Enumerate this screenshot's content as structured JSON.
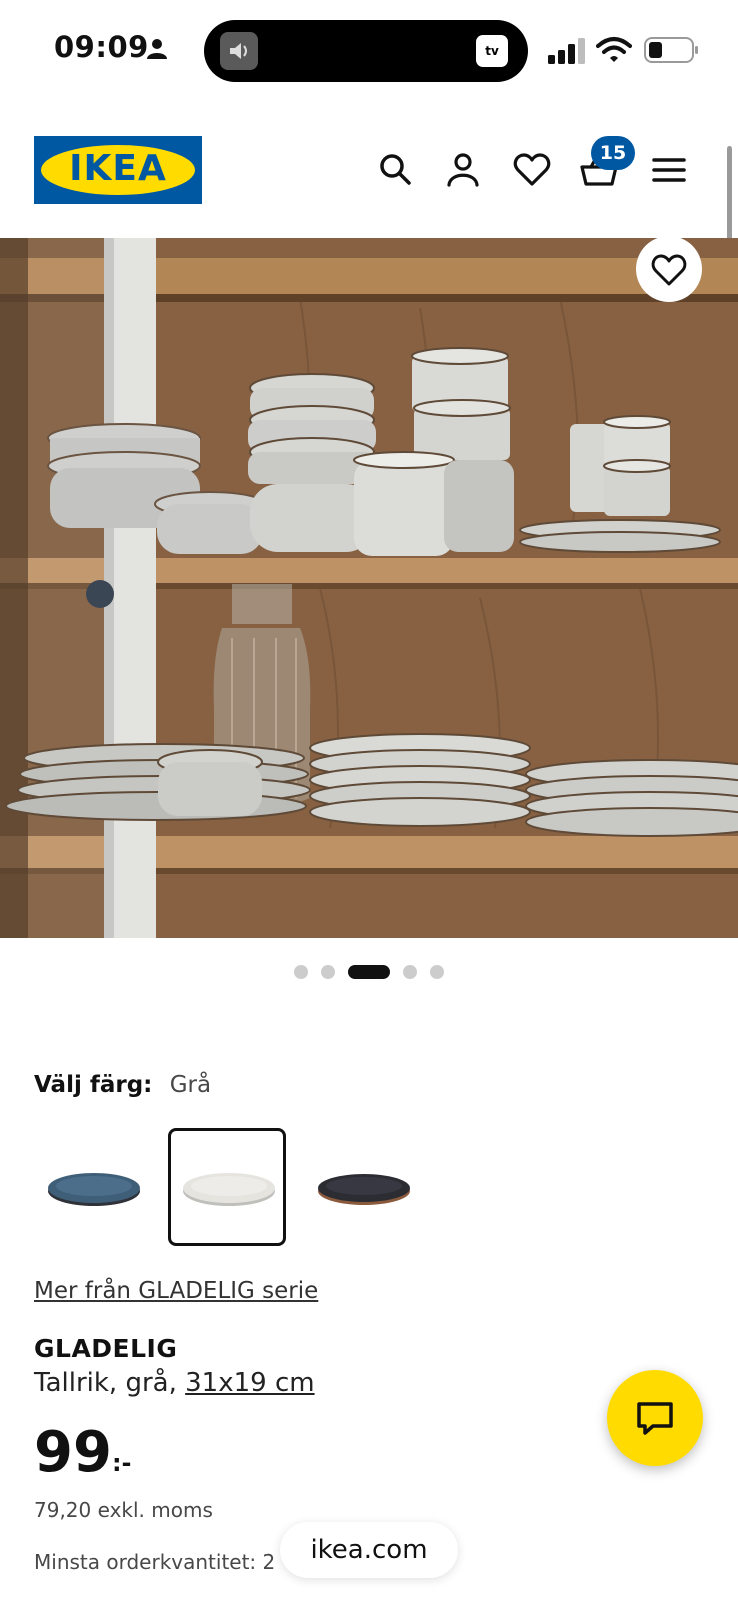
{
  "status_bar": {
    "time": "09:09",
    "appletv": "tv"
  },
  "header": {
    "logo_text": "IKEA",
    "cart_count": "15"
  },
  "gallery": {
    "dot_count": 5,
    "active_index": 2
  },
  "color_selector": {
    "label": "Välj färg:",
    "value": "Grå",
    "swatches": [
      {
        "name": "blå",
        "color": "#3f5f79"
      },
      {
        "name": "grå",
        "color": "#e6e4df"
      },
      {
        "name": "mörkgrå",
        "color": "#2c2d33"
      }
    ],
    "selected_index": 1
  },
  "series_link": "Mer från GLADELIG serie",
  "product": {
    "name": "GLADELIG",
    "desc_prefix": "Tallrik, grå, ",
    "dimension": "31x19 cm",
    "price_int": "99",
    "price_suffix": ":-",
    "ex_vat": "79,20 exkl. moms",
    "min_qty": "Minsta orderkvantitet: 2"
  },
  "browser": {
    "url": "ikea.com"
  },
  "colors": {
    "ikea_blue": "#0058a3",
    "ikea_yellow": "#ffdb00"
  }
}
